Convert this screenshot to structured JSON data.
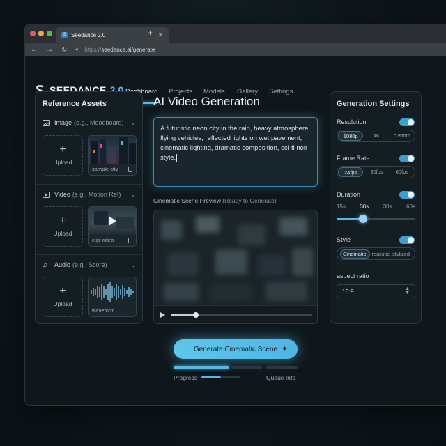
{
  "browser": {
    "tab_title": "Seedance 2.0",
    "url_prefix": "https://",
    "url_main": "seedance.ai/generate"
  },
  "nav": {
    "logo": "SEEDANCE",
    "version": "2.0",
    "links": [
      "Dashboard",
      "Projects",
      "Models",
      "Gallery",
      "Settings"
    ],
    "active": "Dashboard"
  },
  "assets": {
    "title": "Reference Assets",
    "image": {
      "label": "Image",
      "hint": "(e.g., Moodboard)",
      "upload": "Upload",
      "thumb_caption": "sample city"
    },
    "video": {
      "label": "Video",
      "hint": "(e.g., Motion Ref)",
      "upload": "Upload",
      "thumb_caption": "clip video"
    },
    "audio": {
      "label": "Audio",
      "hint": "(e.g., Score)",
      "upload": "Upload",
      "thumb_caption": "waveform"
    }
  },
  "main": {
    "title": "AI Video Generation",
    "prompt": "A futuristic neon city in the rain, heavy atmosphere, flying vehicles, reflected lights on wet pavement, cinematic lighting, dramatic composition, sci-fi noir style.",
    "preview_label": "Cinematic Scene Preview",
    "preview_status": "(Ready to Generate)",
    "scrub_position": 0.18,
    "generate_label": "Generate Cinematic Scene",
    "progress_label": "Progress",
    "queue_label": "Queue Info"
  },
  "settings": {
    "title": "Generation Settings",
    "resolution": {
      "label": "Resolution",
      "options": [
        "1080p",
        "4K",
        "custom"
      ],
      "selected": "1080p",
      "enabled": true
    },
    "frame_rate": {
      "label": "Frame Rate",
      "options": [
        "24fps",
        "30fps",
        "60fps"
      ],
      "selected": "24fps",
      "enabled": true
    },
    "duration": {
      "label": "Duration",
      "options": [
        "15s",
        "30s",
        "30s",
        "60s"
      ],
      "selected": "30s",
      "enabled": true,
      "value_fraction": 0.34
    },
    "style": {
      "label": "Style",
      "selected": "Cinematic,",
      "others": "realistic, stylized",
      "enabled": true
    },
    "aspect_ratio": {
      "label": "aspect ratio",
      "value": "16:9"
    }
  },
  "colors": {
    "accent": "#58b7e4",
    "panel_bg": "#141d22"
  }
}
